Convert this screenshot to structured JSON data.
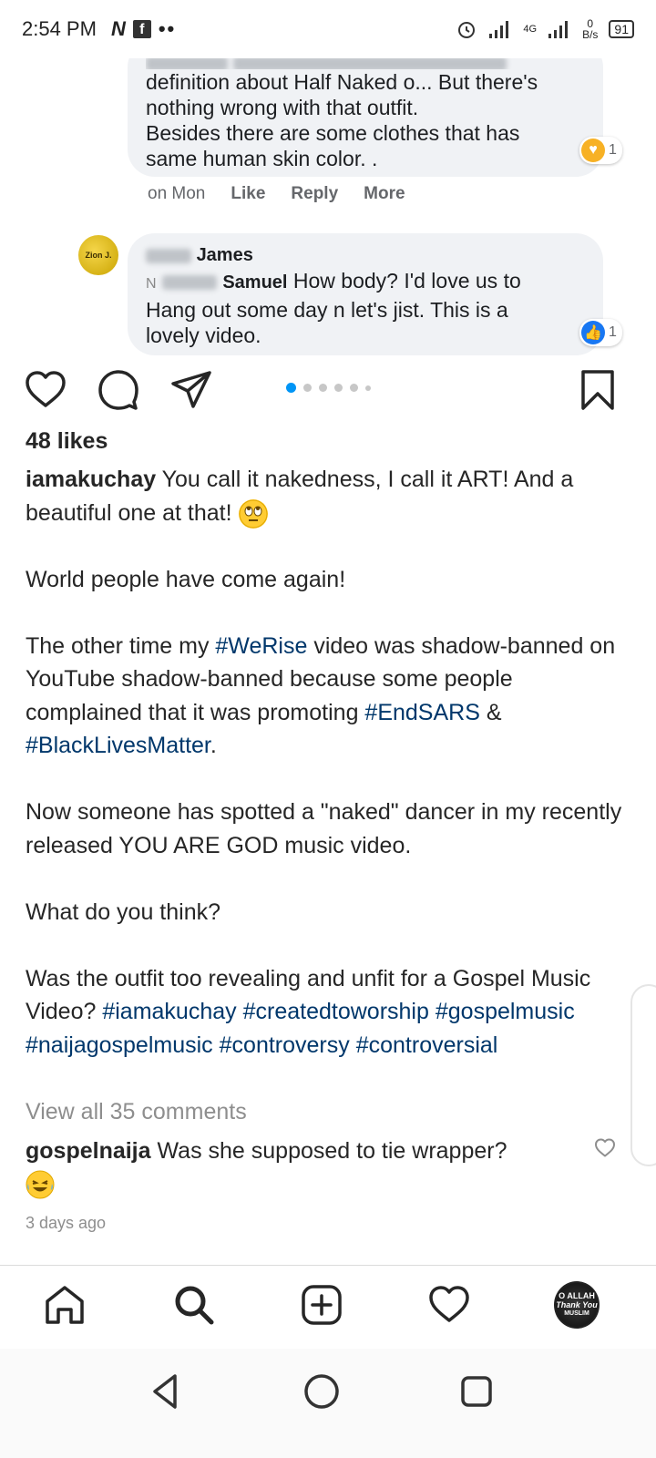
{
  "status": {
    "time": "2:54 PM",
    "net_label": "4G",
    "speed_value": "0",
    "speed_unit": "B/s",
    "battery": "91"
  },
  "fb": {
    "comment1": {
      "lines": [
        "definition about Half Naked o... But there's",
        "nothing wrong with that outfit.",
        "Besides there are some clothes that has",
        "same human skin color. ."
      ],
      "reaction_count": "1",
      "when": "on Mon",
      "like": "Like",
      "reply": "Reply",
      "more": "More"
    },
    "comment2": {
      "avatar_text": "Zion J.",
      "author_visible": "James",
      "mention_visible": "Samuel",
      "prefix_letter": "N",
      "text_line1": " How body? I'd love us to",
      "text_line2": "Hang out some day n let's jist. This is a",
      "text_line3": "lovely video.",
      "reaction_count": "1"
    }
  },
  "post": {
    "likes": "48 likes",
    "username": "iamakuchay",
    "caption": {
      "p1": " You call it nakedness, I call it ART! And a beautiful one at that! ",
      "p2": "World people have come again!",
      "p3a": "The other time my ",
      "tag_werise": "#WeRise",
      "p3b": " video was shadow-banned on YouTube shadow-banned because some people complained that it was promoting ",
      "tag_endsars": "#EndSARS",
      "p3c": " & ",
      "tag_blm": "#BlackLivesMatter",
      "p3d": ".",
      "p4": "Now someone has spotted a \"naked\" dancer in my recently released YOU ARE GOD music video.",
      "p5": "What do you think?",
      "p6": "Was the outfit too revealing and unfit for a Gospel Music Video? ",
      "tags_end": [
        "#iamakuchay",
        "#createdtoworship",
        "#gospelmusic",
        "#naijagospelmusic",
        "#controversy",
        "#controversial"
      ]
    },
    "view_all": "View all 35 comments",
    "top_comment": {
      "username": "gospelnaija",
      "text": " Was she supposed to tie wrapper?"
    },
    "time_ago": "3 days ago",
    "carousel": {
      "count": 6,
      "active_index": 0
    }
  },
  "profile_pic_text": [
    "O ALLAH",
    "Thank You",
    "MUSLIM"
  ],
  "colors": {
    "hashtag": "#00376b",
    "carousel_active": "#0095f6",
    "fb_like_blue": "#1877f2"
  }
}
